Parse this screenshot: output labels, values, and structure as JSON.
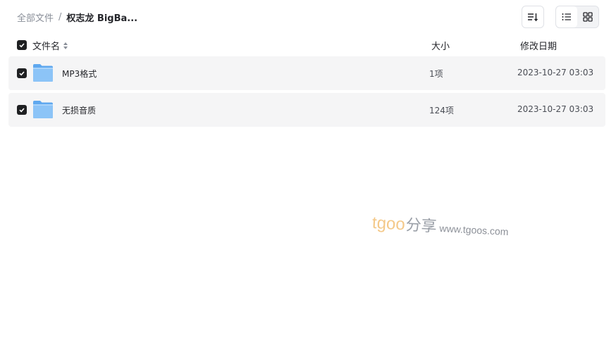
{
  "breadcrumb": {
    "root": "全部文件",
    "separator": "/",
    "current": "权志龙 BigBa..."
  },
  "toolbar": {
    "sort_icon": "sort-icon",
    "list_view_icon": "list-view-icon",
    "grid_view_icon": "grid-view-icon",
    "active_view": "list"
  },
  "table": {
    "columns": {
      "name": "文件名",
      "size": "大小",
      "modified": "修改日期"
    },
    "rows": [
      {
        "name": "MP3格式",
        "count": "1项",
        "modified": "2023-10-27 03:03",
        "checked": true,
        "icon": "folder-icon"
      },
      {
        "name": "无损音质",
        "count": "124项",
        "modified": "2023-10-27 03:03",
        "checked": true,
        "icon": "folder-icon"
      }
    ]
  },
  "watermark": {
    "brand": "tgoo",
    "share": "分享",
    "url": "www.tgoos.com"
  },
  "colors": {
    "row_background": "#f5f5f6",
    "checkbox": "#1f2022",
    "folder": "#7cb9f4",
    "watermark_brand": "#f4c98a"
  }
}
